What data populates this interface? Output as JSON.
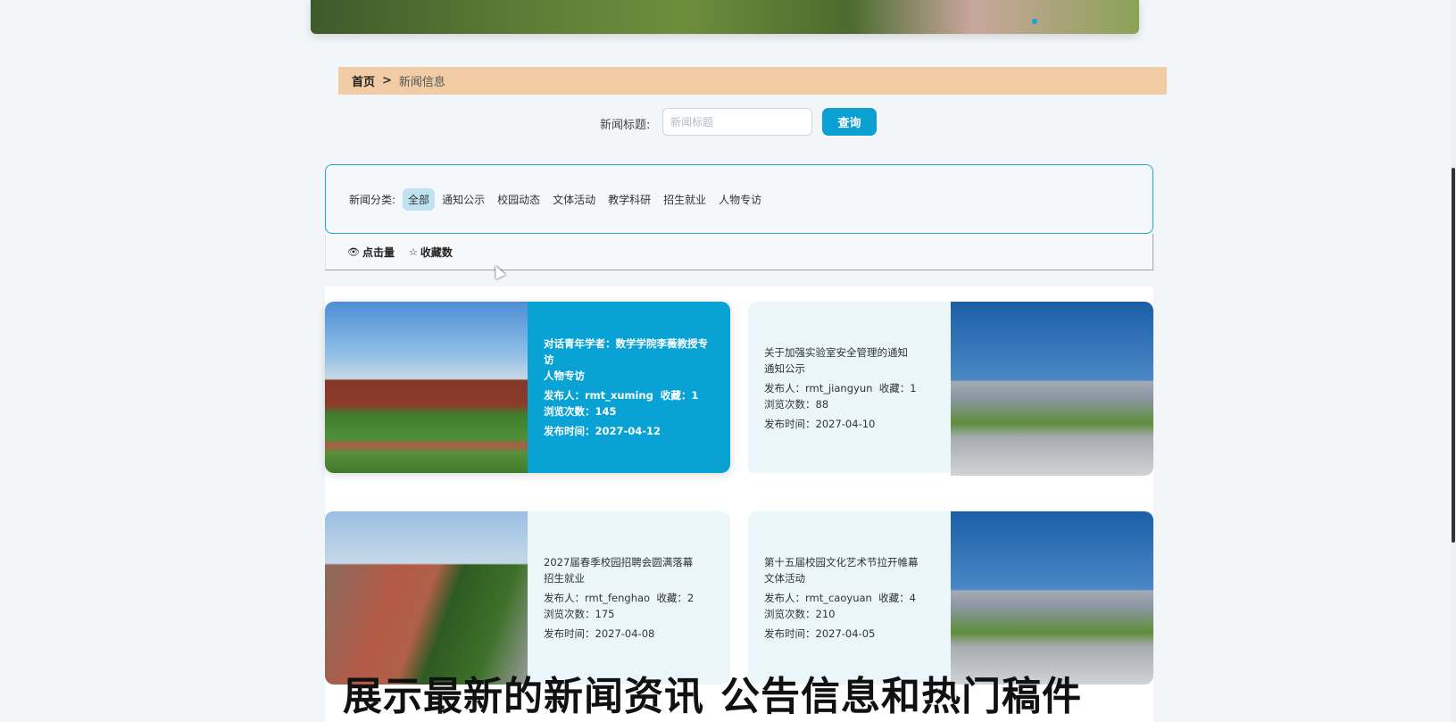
{
  "breadcrumb": {
    "home": "首页",
    "separator": ">",
    "current": "新闻信息"
  },
  "search": {
    "label": "新闻标题:",
    "placeholder": "新闻标题",
    "value": "",
    "button": "查询"
  },
  "categories": {
    "label": "新闻分类:",
    "items": [
      "全部",
      "通知公示",
      "校园动态",
      "文体活动",
      "教学科研",
      "招生就业",
      "人物专访"
    ],
    "active": "全部"
  },
  "sort": {
    "clicks": "点击量",
    "favorites": "收藏数"
  },
  "news": [
    {
      "title": "对话青年学者：数学学院李薇教授专访",
      "category": "人物专访",
      "publisher": "发布人：rmt_xuming",
      "favorites": "收藏：1",
      "views": "浏览次数：145",
      "date": "发布时间：2027-04-12"
    },
    {
      "title": "关于加强实验室安全管理的通知",
      "category": "通知公示",
      "publisher": "发布人：rmt_jiangyun",
      "favorites": "收藏：1",
      "views": "浏览次数：88",
      "date": "发布时间：2027-04-10"
    },
    {
      "title": "2027届春季校园招聘会圆满落幕",
      "category": "招生就业",
      "publisher": "发布人：rmt_fenghao",
      "favorites": "收藏：2",
      "views": "浏览次数：175",
      "date": "发布时间：2027-04-08"
    },
    {
      "title": "第十五届校园文化艺术节拉开帷幕",
      "category": "文体活动",
      "publisher": "发布人：rmt_caoyuan",
      "favorites": "收藏：4",
      "views": "浏览次数：210",
      "date": "发布时间：2027-04-05"
    }
  ],
  "caption": {
    "part1": "展示最新的新闻资讯",
    "part2": "公告信息和热门稿件"
  },
  "colors": {
    "accent": "#0aa0d2",
    "breadcrumb_bg": "#f1cca4",
    "card_bg": "#eaf6f9"
  },
  "icons": {
    "clicks": "eye-icon",
    "favorites": "star-icon"
  }
}
